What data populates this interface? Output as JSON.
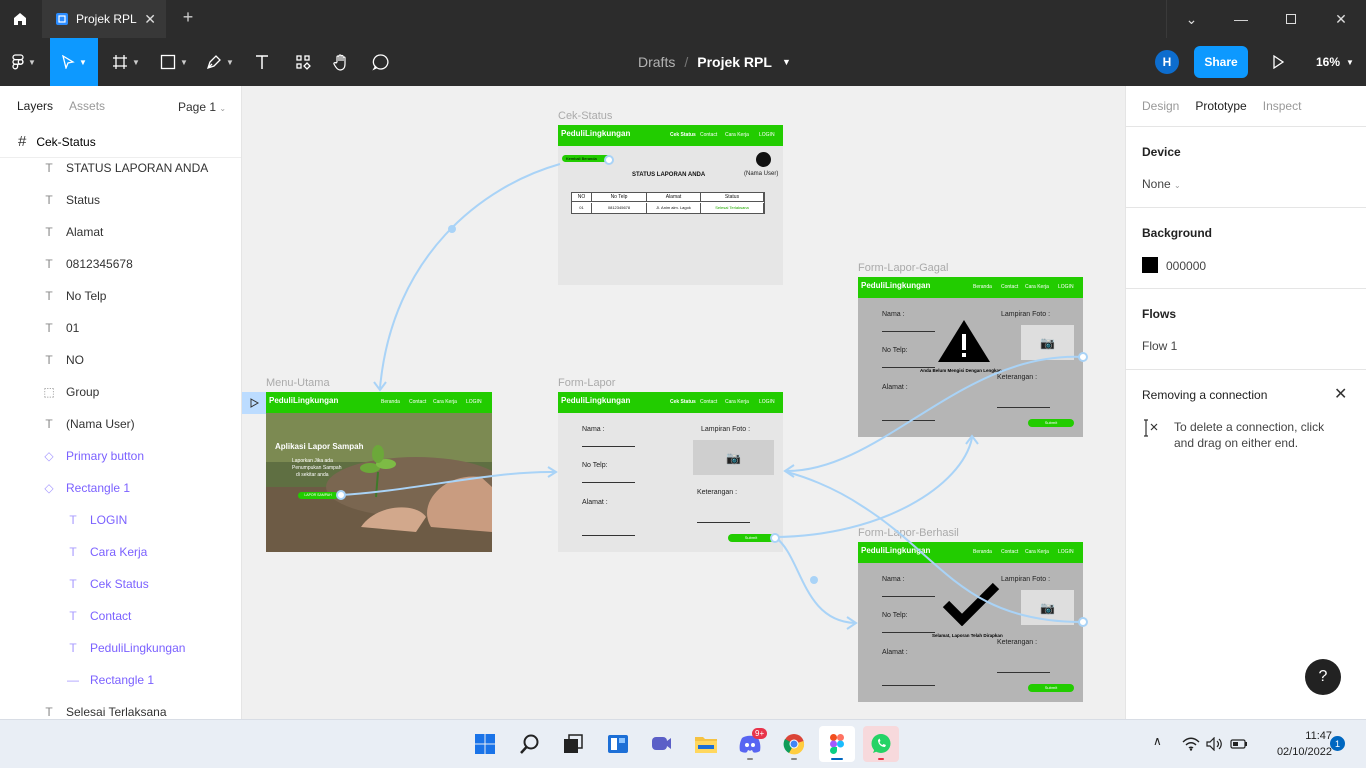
{
  "titlebar": {
    "tab_title": "Projek RPL"
  },
  "toolbar": {
    "breadcrumb_drafts": "Drafts",
    "breadcrumb_separator": "/",
    "file_name": "Projek RPL",
    "avatar_initial": "H",
    "share_label": "Share",
    "zoom": "16%"
  },
  "left_panel": {
    "tab_layers": "Layers",
    "tab_assets": "Assets",
    "page_selector": "Page 1",
    "frame_name": "Cek-Status",
    "layers": [
      {
        "name": "STATUS LAPORAN ANDA",
        "icon": "text-icon"
      },
      {
        "name": "Status",
        "icon": "text-icon"
      },
      {
        "name": "Alamat",
        "icon": "text-icon"
      },
      {
        "name": "0812345678",
        "icon": "text-icon"
      },
      {
        "name": "No Telp",
        "icon": "text-icon"
      },
      {
        "name": "01",
        "icon": "text-icon"
      },
      {
        "name": "NO",
        "icon": "text-icon"
      },
      {
        "name": "Group",
        "icon": "group-icon"
      },
      {
        "name": "(Nama User)",
        "icon": "text-icon"
      },
      {
        "name": "Primary button",
        "icon": "component-icon"
      },
      {
        "name": "Rectangle 1",
        "icon": "component-icon"
      },
      {
        "name": "LOGIN",
        "icon": "text-icon"
      },
      {
        "name": "Cara Kerja",
        "icon": "text-icon"
      },
      {
        "name": "Cek Status",
        "icon": "text-icon"
      },
      {
        "name": "Contact",
        "icon": "text-icon"
      },
      {
        "name": "PeduliLingkungan",
        "icon": "text-icon"
      },
      {
        "name": "Rectangle 1",
        "icon": "line-icon"
      },
      {
        "name": "Selesai Terlaksana",
        "icon": "text-icon"
      }
    ]
  },
  "canvas": {
    "brand": "PeduliLingkungan",
    "nav_main": [
      "Beranda",
      "Contact",
      "Cara Kerja",
      "LOGIN"
    ],
    "nav_alt": [
      "Cek Status",
      "Contact",
      "Cara Kerja",
      "LOGIN"
    ],
    "cek_status": {
      "label": "Cek-Status",
      "back_btn": "Kembali Beranda",
      "user": "(Nama User)",
      "heading": "STATUS LAPORAN ANDA",
      "table_headers": [
        "NO",
        "No Telp",
        "Alamat",
        "Status"
      ],
      "table_rows": [
        [
          "01",
          "0812345678",
          "Jl. Anim alm. Lagok",
          "Selesai Terlaksana"
        ]
      ]
    },
    "menu_utama": {
      "label": "Menu-Utama",
      "hero_title": "Aplikasi Lapor Sampah",
      "hero_text_1": "Laporkan Jika ada",
      "hero_text_2": "Penumpukan Sampah",
      "hero_text_3": "di sekitar anda",
      "hero_btn": "LAPOR SAMPAH"
    },
    "form_lapor": {
      "label": "Form-Lapor",
      "nama": "Nama :",
      "telp": "No Telp:",
      "alamat": "Alamat :",
      "lampiran": "Lampiran Foto :",
      "keterangan": "Keterangan :",
      "submit": "Submit"
    },
    "form_gagal": {
      "label": "Form-Lapor-Gagal",
      "message": "Anda Belum Mengisi Dengan Lengkap"
    },
    "form_berhasil": {
      "label": "Form-Lapor-Berhasil",
      "message": "Selamat, Laporan Telah Dirapkan"
    }
  },
  "right_panel": {
    "tab_design": "Design",
    "tab_prototype": "Prototype",
    "tab_inspect": "Inspect",
    "device_title": "Device",
    "device_value": "None",
    "background_title": "Background",
    "background_value": "000000",
    "background_color": "#000000",
    "flows_title": "Flows",
    "flow_name": "Flow 1",
    "removing_title": "Removing a connection",
    "removing_text_1": "To delete a connection, click",
    "removing_text_2": "and drag on either end."
  },
  "help": "?",
  "taskbar": {
    "time": "11:47",
    "date": "02/10/2022",
    "notifications": "1",
    "discord_badge": "9+"
  }
}
